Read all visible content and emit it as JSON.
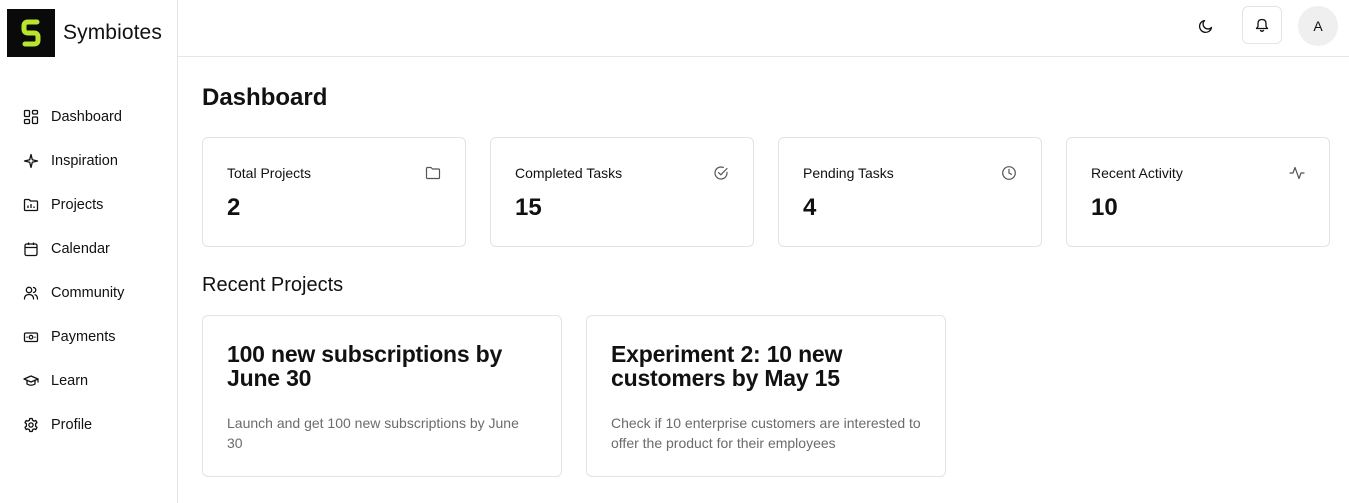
{
  "brand": {
    "name": "Symbiotes",
    "logo_color": "#b8e62e"
  },
  "sidebar": {
    "items": [
      {
        "label": "Dashboard",
        "icon": "dashboard-icon"
      },
      {
        "label": "Inspiration",
        "icon": "sparkle-icon"
      },
      {
        "label": "Projects",
        "icon": "folder-chart-icon"
      },
      {
        "label": "Calendar",
        "icon": "calendar-icon"
      },
      {
        "label": "Community",
        "icon": "users-icon"
      },
      {
        "label": "Payments",
        "icon": "banknote-icon"
      },
      {
        "label": "Learn",
        "icon": "graduation-cap-icon"
      },
      {
        "label": "Profile",
        "icon": "gear-icon"
      }
    ]
  },
  "header": {
    "theme_toggle_icon": "moon-icon",
    "notifications_icon": "bell-icon",
    "avatar_initial": "A"
  },
  "main": {
    "title": "Dashboard",
    "stats": [
      {
        "label": "Total Projects",
        "value": "2",
        "icon": "folder-icon"
      },
      {
        "label": "Completed Tasks",
        "value": "15",
        "icon": "check-circle-icon"
      },
      {
        "label": "Pending Tasks",
        "value": "4",
        "icon": "clock-icon"
      },
      {
        "label": "Recent Activity",
        "value": "10",
        "icon": "activity-icon"
      }
    ],
    "recent_title": "Recent Projects",
    "projects": [
      {
        "title": "100 new subscriptions by June 30",
        "description": "Launch and get 100 new subscriptions by June 30"
      },
      {
        "title": "Experiment 2: 10 new customers by May 15",
        "description": "Check if 10 enterprise customers are interested to offer the product for their employees"
      }
    ]
  }
}
